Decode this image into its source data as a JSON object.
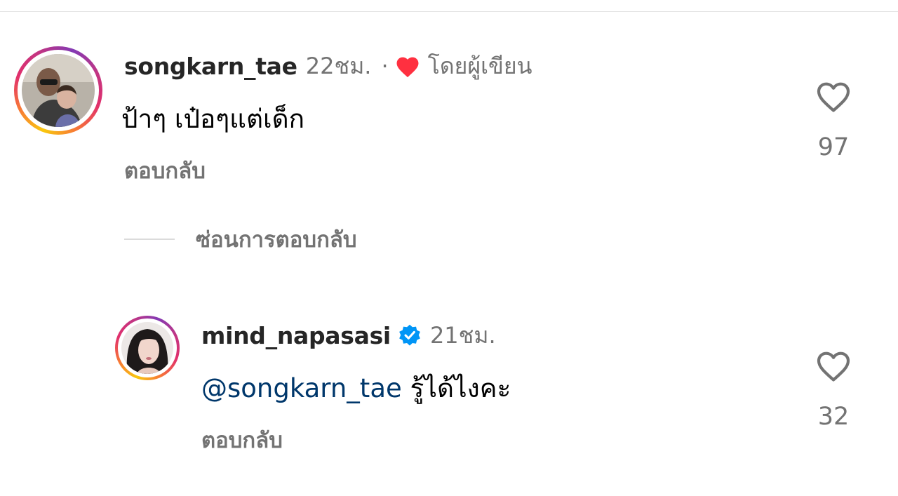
{
  "comments": [
    {
      "username": "songkarn_tae",
      "time": "22ชม.",
      "separator": "·",
      "author_liked": "โดยผู้เขียน",
      "text": "ป้าๆ เป๋อๆแต่เด็ก",
      "reply_label": "ตอบกลับ",
      "like_count": "97"
    }
  ],
  "hide_replies_label": "ซ่อนการตอบกลับ",
  "replies": [
    {
      "username": "mind_napasasi",
      "verified": true,
      "time": "21ชม.",
      "mention": "@songkarn_tae",
      "text": "รู้ได้ไงคะ",
      "reply_label": "ตอบกลับ",
      "like_count": "32"
    }
  ],
  "colors": {
    "text_primary": "#262626",
    "text_secondary": "#737373",
    "mention": "#00376b",
    "heart_red": "#ff3040",
    "verified_blue": "#0095f6"
  },
  "icons": [
    "heart-outline-icon",
    "heart-filled-icon",
    "verified-badge-icon"
  ]
}
